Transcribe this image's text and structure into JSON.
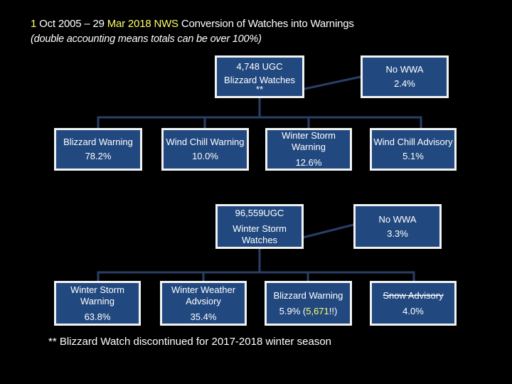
{
  "title": {
    "parts": [
      "1",
      " Oct 2005 – 29 ",
      "Mar 2018 NWS",
      " Conversion of Watches into Warnings"
    ],
    "subtitle": "(double accounting means totals can be over 100%)"
  },
  "colors": {
    "box_fill": "#22497f",
    "box_border": "#f2f2f2",
    "connector": "#2a3f66",
    "highlight": "#ffff66",
    "background": "#000000"
  },
  "blizzard_watch": {
    "root": {
      "count": "4,748 UGC",
      "label": "Blizzard Watches",
      "note": "**"
    },
    "no_wwa": {
      "label": "No WWA",
      "value": "2.4%"
    },
    "children": [
      {
        "label": "Blizzard Warning",
        "value": "78.2%"
      },
      {
        "label": "Wind Chill Warning",
        "value": "10.0%"
      },
      {
        "label": "Winter Storm Warning",
        "value": "12.6%"
      },
      {
        "label": "Wind Chill Advisory",
        "value": "5.1%"
      }
    ]
  },
  "winter_storm_watch": {
    "root": {
      "count": "96,559UGC",
      "label": "Winter Storm Watches"
    },
    "no_wwa": {
      "label": "No WWA",
      "value": "3.3%"
    },
    "children": [
      {
        "label": "Winter Storm Warning",
        "value": "63.8%"
      },
      {
        "label": "Winter Weather Advsiory",
        "value": "35.4%"
      },
      {
        "label": "Blizzard Warning",
        "value": "5.9% (",
        "extra": "5,671",
        "extra_suffix": "!!)"
      },
      {
        "label": "Snow Advisory",
        "value": "4.0%",
        "strikethrough": true
      }
    ]
  },
  "footnote": "** Blizzard Watch discontinued for 2017-2018 winter season"
}
